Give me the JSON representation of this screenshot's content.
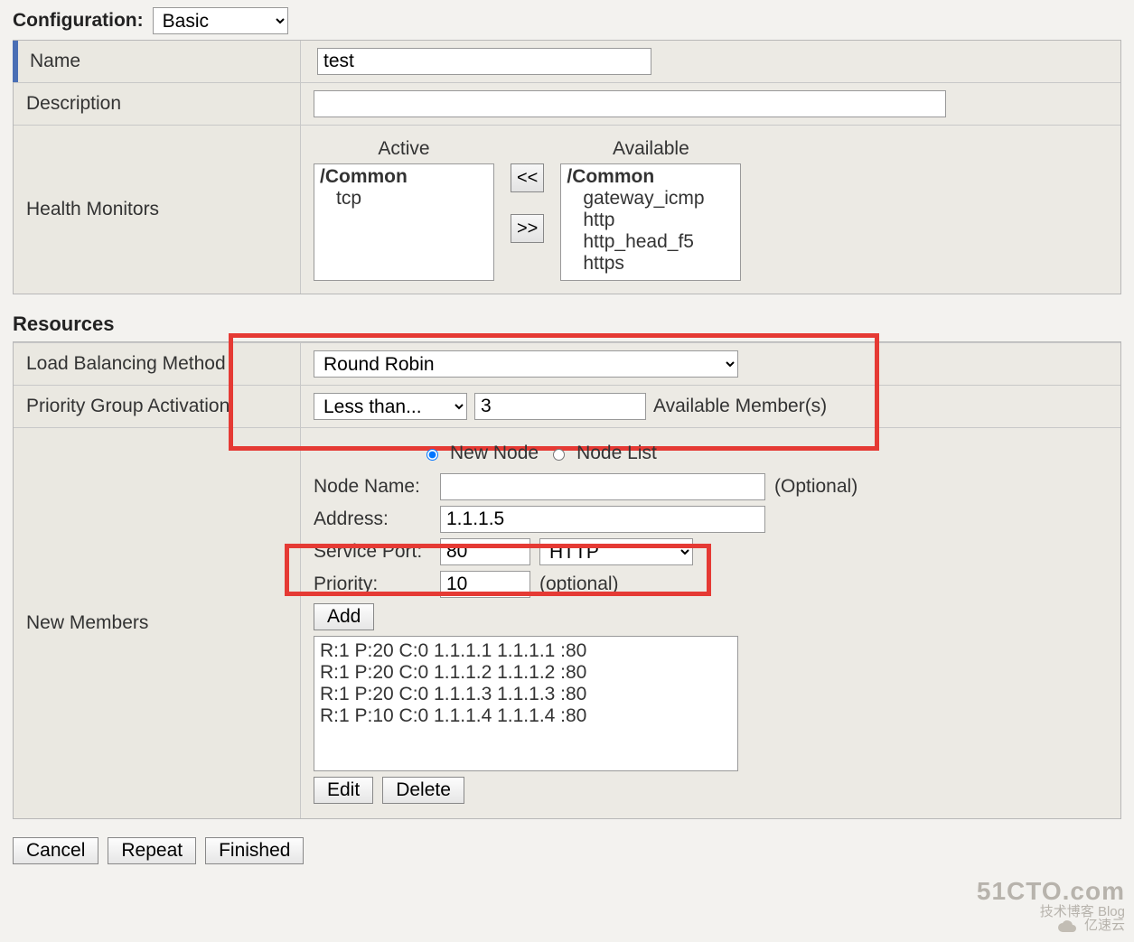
{
  "config": {
    "label": "Configuration:",
    "value": "Basic"
  },
  "general": {
    "name_label": "Name",
    "name_value": "test",
    "desc_label": "Description",
    "desc_value": "",
    "hm_label": "Health Monitors",
    "hm_active_title": "Active",
    "hm_available_title": "Available",
    "hm_active_group": "/Common",
    "hm_active": [
      "tcp"
    ],
    "hm_avail_group": "/Common",
    "hm_avail": [
      "gateway_icmp",
      "http",
      "http_head_f5",
      "https"
    ],
    "move_left": "<<",
    "move_right": ">>"
  },
  "resources": {
    "title": "Resources",
    "lbm_label": "Load Balancing Method",
    "lbm_value": "Round Robin",
    "pga_label": "Priority Group Activation",
    "pga_mode": "Less than...",
    "pga_count": "3",
    "pga_suffix": "Available Member(s)",
    "nm_label": "New Members",
    "radio_new": "New Node",
    "radio_list": "Node List",
    "nodename_label": "Node Name:",
    "nodename_value": "",
    "nodename_hint": "(Optional)",
    "address_label": "Address:",
    "address_value": "1.1.1.5",
    "port_label": "Service Port:",
    "port_value": "80",
    "port_proto": "HTTP",
    "prio_label": "Priority:",
    "prio_value": "10",
    "prio_hint": "(optional)",
    "add_btn": "Add",
    "members": [
      "R:1 P:20 C:0 1.1.1.1 1.1.1.1 :80",
      "R:1 P:20 C:0 1.1.1.2 1.1.1.2 :80",
      "R:1 P:20 C:0 1.1.1.3 1.1.1.3 :80",
      "R:1 P:10 C:0 1.1.1.4 1.1.1.4 :80"
    ],
    "edit_btn": "Edit",
    "delete_btn": "Delete"
  },
  "footer": {
    "cancel": "Cancel",
    "repeat": "Repeat",
    "finished": "Finished"
  },
  "watermark": {
    "l1": "51CTO.com",
    "l2": "技术博客  Blog",
    "l3": "亿速云"
  }
}
